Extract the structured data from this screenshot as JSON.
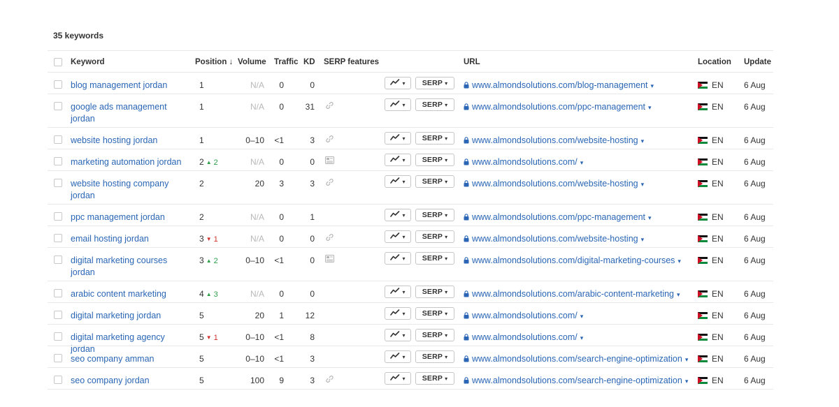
{
  "summary": {
    "count_label": "35 keywords"
  },
  "columns": {
    "keyword": "Keyword",
    "position": "Position",
    "position_sort_arrow": "↓",
    "volume": "Volume",
    "traffic": "Traffic",
    "kd": "KD",
    "serp_features": "SERP features",
    "url": "URL",
    "location": "Location",
    "update": "Update"
  },
  "buttons": {
    "serp_label": "SERP",
    "caret": "▾"
  },
  "colors": {
    "link": "#2a66b5",
    "up": "#2e9e4a",
    "down": "#d0312d",
    "na": "#b8b8b8"
  },
  "rows": [
    {
      "keyword": "blog management jordan",
      "position": "1",
      "change": "",
      "change_dir": "",
      "volume": "N/A",
      "traffic": "0",
      "kd": "0",
      "serp_feature": "",
      "url": "www.almondsolutions.com/blog-management",
      "lang": "EN",
      "update": "6 Aug"
    },
    {
      "keyword": "google ads management jordan",
      "position": "1",
      "change": "",
      "change_dir": "",
      "volume": "N/A",
      "traffic": "0",
      "kd": "31",
      "serp_feature": "link-icon",
      "url": "www.almondsolutions.com/ppc-management",
      "lang": "EN",
      "update": "6 Aug"
    },
    {
      "keyword": "website hosting jordan",
      "position": "1",
      "change": "",
      "change_dir": "",
      "volume": "0–10",
      "traffic": "<1",
      "kd": "3",
      "serp_feature": "link-icon",
      "url": "www.almondsolutions.com/website-hosting",
      "lang": "EN",
      "update": "6 Aug"
    },
    {
      "keyword": "marketing automation jordan",
      "position": "2",
      "change": "2",
      "change_dir": "up",
      "volume": "N/A",
      "traffic": "0",
      "kd": "0",
      "serp_feature": "image-icon",
      "url": "www.almondsolutions.com/",
      "lang": "EN",
      "update": "6 Aug"
    },
    {
      "keyword": "website hosting company jordan",
      "position": "2",
      "change": "",
      "change_dir": "",
      "volume": "20",
      "traffic": "3",
      "kd": "3",
      "serp_feature": "link-icon",
      "url": "www.almondsolutions.com/website-hosting",
      "lang": "EN",
      "update": "6 Aug"
    },
    {
      "keyword": "ppc management jordan",
      "position": "2",
      "change": "",
      "change_dir": "",
      "volume": "N/A",
      "traffic": "0",
      "kd": "1",
      "serp_feature": "",
      "url": "www.almondsolutions.com/ppc-management",
      "lang": "EN",
      "update": "6 Aug"
    },
    {
      "keyword": "email hosting jordan",
      "position": "3",
      "change": "1",
      "change_dir": "down",
      "volume": "N/A",
      "traffic": "0",
      "kd": "0",
      "serp_feature": "link-icon",
      "url": "www.almondsolutions.com/website-hosting",
      "lang": "EN",
      "update": "6 Aug"
    },
    {
      "keyword": "digital marketing courses jordan",
      "position": "3",
      "change": "2",
      "change_dir": "up",
      "volume": "0–10",
      "traffic": "<1",
      "kd": "0",
      "serp_feature": "image-icon",
      "url": "www.almondsolutions.com/digital-marketing-courses",
      "lang": "EN",
      "update": "6 Aug"
    },
    {
      "keyword": "arabic content marketing",
      "position": "4",
      "change": "3",
      "change_dir": "up",
      "volume": "N/A",
      "traffic": "0",
      "kd": "0",
      "serp_feature": "",
      "url": "www.almondsolutions.com/arabic-content-marketing",
      "lang": "EN",
      "update": "6 Aug"
    },
    {
      "keyword": "digital marketing jordan",
      "position": "5",
      "change": "",
      "change_dir": "",
      "volume": "20",
      "traffic": "1",
      "kd": "12",
      "serp_feature": "",
      "url": "www.almondsolutions.com/",
      "lang": "EN",
      "update": "6 Aug"
    },
    {
      "keyword": "digital marketing agency jordan",
      "position": "5",
      "change": "1",
      "change_dir": "down",
      "volume": "0–10",
      "traffic": "<1",
      "kd": "8",
      "serp_feature": "",
      "url": "www.almondsolutions.com/",
      "lang": "EN",
      "update": "6 Aug"
    },
    {
      "keyword": "seo company amman",
      "position": "5",
      "change": "",
      "change_dir": "",
      "volume": "0–10",
      "traffic": "<1",
      "kd": "3",
      "serp_feature": "",
      "url": "www.almondsolutions.com/search-engine-optimization",
      "lang": "EN",
      "update": "6 Aug"
    },
    {
      "keyword": "seo company jordan",
      "position": "5",
      "change": "",
      "change_dir": "",
      "volume": "100",
      "traffic": "9",
      "kd": "3",
      "serp_feature": "link-icon",
      "url": "www.almondsolutions.com/search-engine-optimization",
      "lang": "EN",
      "update": "6 Aug"
    }
  ]
}
